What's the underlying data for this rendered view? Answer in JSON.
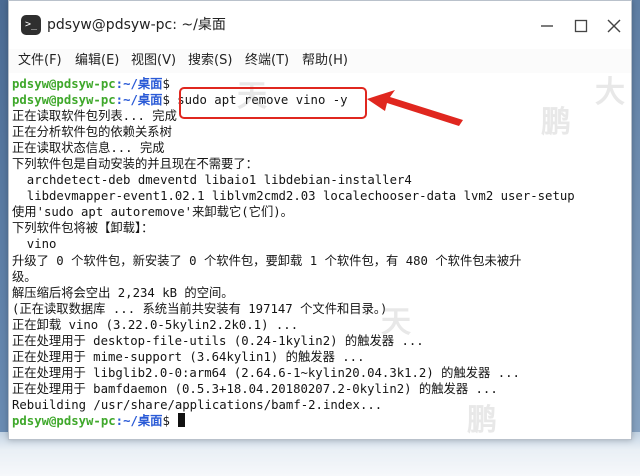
{
  "window": {
    "title": "pdsyw@pdsyw-pc: ~/桌面",
    "app_icon_glyph": ">_"
  },
  "menu": [
    {
      "label": "文件(F)"
    },
    {
      "label": "编辑(E)"
    },
    {
      "label": "视图(V)"
    },
    {
      "label": "搜索(S)"
    },
    {
      "label": "终端(T)"
    },
    {
      "label": "帮助(H)"
    }
  ],
  "prompt": {
    "user": "pdsyw@pdsyw-pc",
    "sep": ":",
    "path": "~/桌面",
    "symbol": "$"
  },
  "terminal": {
    "lines": [
      {
        "type": "prompt",
        "cmd": ""
      },
      {
        "type": "prompt",
        "cmd": "sudo apt remove vino -y"
      },
      {
        "type": "text",
        "text": "正在读取软件包列表... 完成"
      },
      {
        "type": "text",
        "text": "正在分析软件包的依赖关系树"
      },
      {
        "type": "text",
        "text": "正在读取状态信息... 完成"
      },
      {
        "type": "text",
        "text": "下列软件包是自动安装的并且现在不需要了："
      },
      {
        "type": "text",
        "text": "  archdetect-deb dmeventd libaio1 libdebian-installer4"
      },
      {
        "type": "text",
        "text": "  libdevmapper-event1.02.1 liblvm2cmd2.03 localechooser-data lvm2 user-setup"
      },
      {
        "type": "text",
        "text": "使用'sudo apt autoremove'来卸载它(它们)。"
      },
      {
        "type": "text",
        "text": "下列软件包将被【卸载】："
      },
      {
        "type": "text",
        "text": "  vino"
      },
      {
        "type": "text",
        "text": "升级了 0 个软件包，新安装了 0 个软件包，要卸载 1 个软件包，有 480 个软件包未被升"
      },
      {
        "type": "text",
        "text": "级。"
      },
      {
        "type": "text",
        "text": "解压缩后将会空出 2,234 kB 的空间。"
      },
      {
        "type": "text",
        "text": "(正在读取数据库 ... 系统当前共安装有 197147 个文件和目录。)"
      },
      {
        "type": "text",
        "text": "正在卸载 vino (3.22.0-5kylin2.2k0.1) ..."
      },
      {
        "type": "text",
        "text": "正在处理用于 desktop-file-utils (0.24-1kylin2) 的触发器 ..."
      },
      {
        "type": "text",
        "text": "正在处理用于 mime-support (3.64kylin1) 的触发器 ..."
      },
      {
        "type": "text",
        "text": "正在处理用于 libglib2.0-0:arm64 (2.64.6-1~kylin20.04.3k1.2) 的触发器 ..."
      },
      {
        "type": "text",
        "text": "正在处理用于 bamfdaemon (0.5.3+18.04.20180207.2-0kylin2) 的触发器 ..."
      },
      {
        "type": "text",
        "text": "Rebuilding /usr/share/applications/bamf-2.index..."
      },
      {
        "type": "prompt-cursor",
        "cmd": ""
      }
    ]
  },
  "watermark": {
    "chars": [
      "天",
      "天",
      "鹏",
      "鹏",
      "大"
    ]
  },
  "colors": {
    "annotation_red": "#e0271f",
    "prompt_green": "#3fa82b",
    "prompt_blue": "#2b5bd6"
  }
}
